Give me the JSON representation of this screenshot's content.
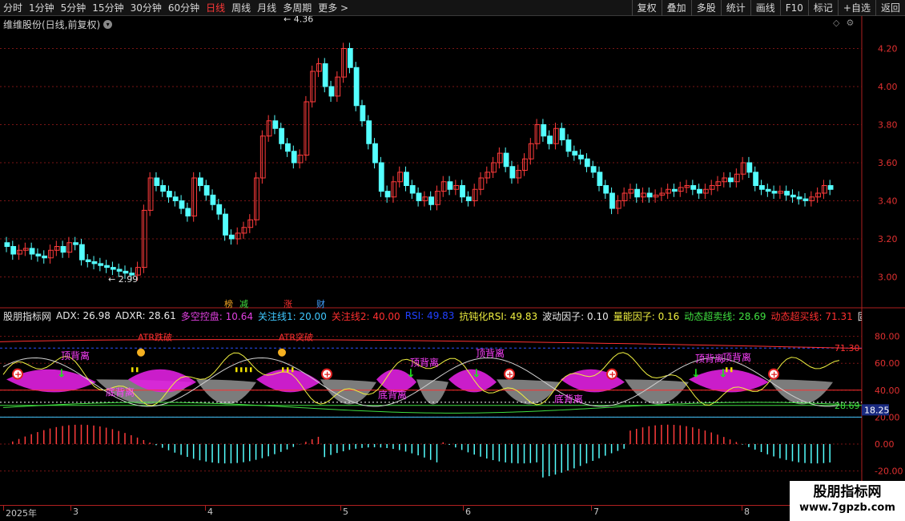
{
  "toolbar": {
    "periods": [
      "分时",
      "1分钟",
      "5分钟",
      "15分钟",
      "30分钟",
      "60分钟",
      "日线",
      "周线",
      "月线",
      "多周期",
      "更多 >"
    ],
    "active_index": 6,
    "right_buttons": [
      "复权",
      "叠加",
      "多股",
      "统计",
      "画线",
      "F10",
      "标记",
      "+自选",
      "返回"
    ]
  },
  "stock": {
    "title": "维维股份(日线,前复权)"
  },
  "price_axis": [
    "4.20",
    "4.00",
    "3.80",
    "3.60",
    "3.40",
    "3.20",
    "3.00"
  ],
  "price_markers": {
    "high": "4.36",
    "low": "2.99"
  },
  "main_labels": [
    "榜",
    "减",
    "涨",
    "财"
  ],
  "indicator": {
    "name": "股朋指标网",
    "adx": {
      "label": "ADX: ",
      "value": "26.98",
      "color": "#e8e8e8"
    },
    "adxr": {
      "label": "ADXR: ",
      "value": "28.61",
      "color": "#e8e8e8"
    },
    "duokong": {
      "label": "多空控盘: ",
      "value": "10.64",
      "color": "#e040e0"
    },
    "guanzhu1": {
      "label": "关注线1: ",
      "value": "20.00",
      "color": "#40c8ff"
    },
    "guanzhu2": {
      "label": "关注线2: ",
      "value": "40.00",
      "color": "#ff3030"
    },
    "rsi": {
      "label": "RSI: ",
      "value": "49.83",
      "color": "#2040ff"
    },
    "kdrsi": {
      "label": "抗钝化RSI: ",
      "value": "49.83",
      "color": "#f0f040"
    },
    "bodong": {
      "label": "波动因子: ",
      "value": "0.10",
      "color": "#e8e8e8"
    },
    "liangneng": {
      "label": "量能因子: ",
      "value": "0.16",
      "color": "#f0f040"
    },
    "dtcm": {
      "label": "动态超卖线: ",
      "value": "28.69",
      "color": "#40e040"
    },
    "dtcmr": {
      "label": "动态超买线: ",
      "value": "71.31",
      "color": "#ff3030"
    },
    "gudingcankao": {
      "label": "固定参考线",
      "value": "",
      "color": "#e8e8e8"
    }
  },
  "ind_axis": [
    "80.00",
    "60.00",
    "40.00",
    "20.00",
    "0.00",
    "-20.00"
  ],
  "ind_side": {
    "overbought": "71.30",
    "oversold": "28.69",
    "current": "18.25"
  },
  "annotations": {
    "top_div": "顶背离",
    "bottom_div": "底背离",
    "atr_break": "ATR跌破",
    "atr_cross": "ATR突破"
  },
  "xaxis": [
    "2025年",
    "3",
    "4",
    "5",
    "6",
    "7",
    "8"
  ],
  "watermark": {
    "line1": "股朋指标网",
    "line2": "www.7gpzb.com"
  },
  "colors": {
    "up": "#ff3b3b",
    "down": "#54ffff",
    "grid": "#7a1515",
    "axis": "#b02020"
  }
}
